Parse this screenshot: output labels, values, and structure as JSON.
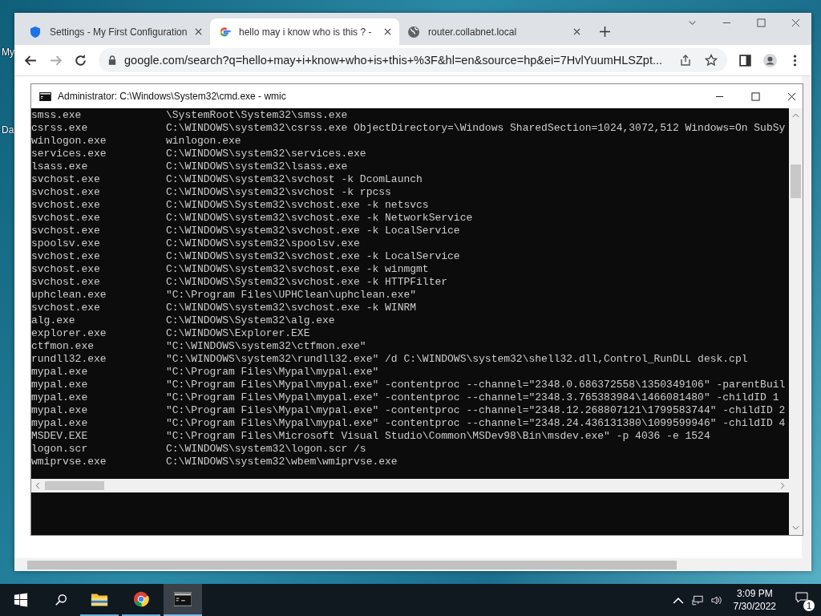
{
  "desktop_icons": [
    {
      "label": "My"
    },
    {
      "label": "Da"
    }
  ],
  "browser": {
    "tabs": [
      {
        "label": "Settings - My First Configuration",
        "kind": "shield",
        "selected": false
      },
      {
        "label": "hello may i know who is this ? -",
        "kind": "google",
        "selected": true
      },
      {
        "label": "router.collabnet.local",
        "kind": "globe",
        "selected": false
      }
    ],
    "address": "google.com/search?q=hello+may+i+know+who+is+this+%3F&hl=en&source=hp&ei=7HvlYuumHLSZpt..."
  },
  "console": {
    "title": "Administrator: C:\\Windows\\System32\\cmd.exe - wmic",
    "rows": [
      {
        "name": "smss.exe",
        "command": "\\SystemRoot\\System32\\smss.exe"
      },
      {
        "name": "csrss.exe",
        "command": "C:\\WINDOWS\\system32\\csrss.exe ObjectDirectory=\\Windows SharedSection=1024,3072,512 Windows=On SubSy"
      },
      {
        "name": "winlogon.exe",
        "command": "winlogon.exe"
      },
      {
        "name": "services.exe",
        "command": "C:\\WINDOWS\\system32\\services.exe"
      },
      {
        "name": "lsass.exe",
        "command": "C:\\WINDOWS\\system32\\lsass.exe"
      },
      {
        "name": "svchost.exe",
        "command": "C:\\WINDOWS\\system32\\svchost -k DcomLaunch"
      },
      {
        "name": "svchost.exe",
        "command": "C:\\WINDOWS\\system32\\svchost -k rpcss"
      },
      {
        "name": "svchost.exe",
        "command": "C:\\WINDOWS\\System32\\svchost.exe -k netsvcs"
      },
      {
        "name": "svchost.exe",
        "command": "C:\\WINDOWS\\system32\\svchost.exe -k NetworkService"
      },
      {
        "name": "svchost.exe",
        "command": "C:\\WINDOWS\\system32\\svchost.exe -k LocalService"
      },
      {
        "name": "spoolsv.exe",
        "command": "C:\\WINDOWS\\system32\\spoolsv.exe"
      },
      {
        "name": "svchost.exe",
        "command": "C:\\WINDOWS\\system32\\svchost.exe -k LocalService"
      },
      {
        "name": "svchost.exe",
        "command": "C:\\WINDOWS\\system32\\svchost.exe -k winmgmt"
      },
      {
        "name": "svchost.exe",
        "command": "C:\\WINDOWS\\System32\\svchost.exe -k HTTPFilter"
      },
      {
        "name": "uphclean.exe",
        "command": "\"C:\\Program Files\\UPHClean\\uphclean.exe\""
      },
      {
        "name": "svchost.exe",
        "command": "C:\\WINDOWS\\system32\\svchost.exe -k WINRM"
      },
      {
        "name": "alg.exe",
        "command": "C:\\WINDOWS\\System32\\alg.exe"
      },
      {
        "name": "explorer.exe",
        "command": "C:\\WINDOWS\\Explorer.EXE"
      },
      {
        "name": "ctfmon.exe",
        "command": "\"C:\\WINDOWS\\system32\\ctfmon.exe\""
      },
      {
        "name": "rundll32.exe",
        "command": "\"C:\\WINDOWS\\system32\\rundll32.exe\" /d C:\\WINDOWS\\system32\\shell32.dll,Control_RunDLL desk.cpl"
      },
      {
        "name": "mypal.exe",
        "command": "\"C:\\Program Files\\Mypal\\mypal.exe\""
      },
      {
        "name": "mypal.exe",
        "command": "\"C:\\Program Files\\Mypal\\mypal.exe\" -contentproc --channel=\"2348.0.686372558\\1350349106\" -parentBuil"
      },
      {
        "name": "mypal.exe",
        "command": "\"C:\\Program Files\\Mypal\\mypal.exe\" -contentproc --channel=\"2348.3.765383984\\1466081480\" -childID 1"
      },
      {
        "name": "mypal.exe",
        "command": "\"C:\\Program Files\\Mypal\\mypal.exe\" -contentproc --channel=\"2348.12.268807121\\1799583744\" -childID 2"
      },
      {
        "name": "mypal.exe",
        "command": "\"C:\\Program Files\\Mypal\\mypal.exe\" -contentproc --channel=\"2348.24.436131380\\1099599946\" -childID 4"
      },
      {
        "name": "MSDEV.EXE",
        "command": "\"C:\\Program Files\\Microsoft Visual Studio\\Common\\MSDev98\\Bin\\msdev.exe\" -p 4036 -e 1524"
      },
      {
        "name": "logon.scr",
        "command": "C:\\WINDOWS\\system32\\logon.scr /s"
      },
      {
        "name": "wmiprvse.exe",
        "command": "C:\\WINDOWS\\system32\\wbem\\wmiprvse.exe"
      }
    ]
  },
  "taskbar": {
    "apps": [
      {
        "kind": "explorer",
        "active": false
      },
      {
        "kind": "chrome",
        "active": false
      },
      {
        "kind": "console",
        "active": true
      }
    ],
    "time": "3:09 PM",
    "date": "7/30/2022",
    "notifications": "1"
  }
}
